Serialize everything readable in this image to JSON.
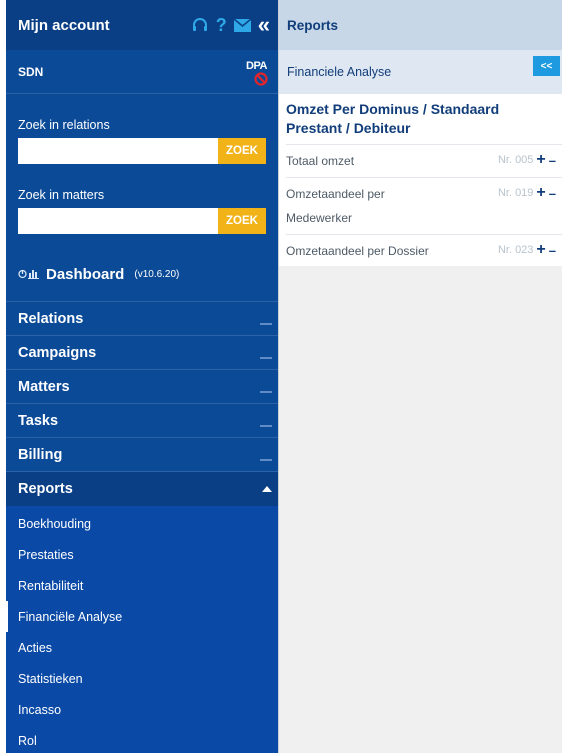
{
  "sidebar": {
    "title": "Mijn account",
    "header_icons": [
      "headset-icon",
      "help-icon",
      "mail-icon",
      "collapse-icon"
    ],
    "org": "SDN",
    "dpa_label": "DPA",
    "search_relations": {
      "label": "Zoek in relations",
      "value": "",
      "button": "ZOEK"
    },
    "search_matters": {
      "label": "Zoek in matters",
      "value": "",
      "button": "ZOEK"
    },
    "dashboard": {
      "label": "Dashboard",
      "version": "(v10.6.20)"
    },
    "menu": [
      {
        "label": "Relations"
      },
      {
        "label": "Campaigns"
      },
      {
        "label": "Matters"
      },
      {
        "label": "Tasks"
      },
      {
        "label": "Billing"
      },
      {
        "label": "Reports"
      }
    ],
    "submenu": [
      {
        "label": "Boekhouding"
      },
      {
        "label": "Prestaties"
      },
      {
        "label": "Rentabiliteit"
      },
      {
        "label": "Financiële Analyse"
      },
      {
        "label": "Acties"
      },
      {
        "label": "Statistieken"
      },
      {
        "label": "Incasso"
      },
      {
        "label": "Rol"
      }
    ]
  },
  "main": {
    "header": "Reports",
    "subheader": "Financiele Analyse",
    "collapse_label": "<<",
    "report_title": "Omzet Per Dominus / Standaard Prestant / Debiteur",
    "reports": [
      {
        "name": "Totaal omzet",
        "nr": "Nr. 005"
      },
      {
        "name": "Omzetaandeel per Medewerker",
        "nr": "Nr. 019"
      },
      {
        "name": "Omzetaandeel per Dossier",
        "nr": "Nr. 023"
      }
    ],
    "plus": "+",
    "minus": "–"
  },
  "colors": {
    "sidebar_bg": "#0b4a97",
    "accent_yellow": "#f2b318",
    "accent_blue": "#1e9be0",
    "title_blue": "#113d7a"
  }
}
